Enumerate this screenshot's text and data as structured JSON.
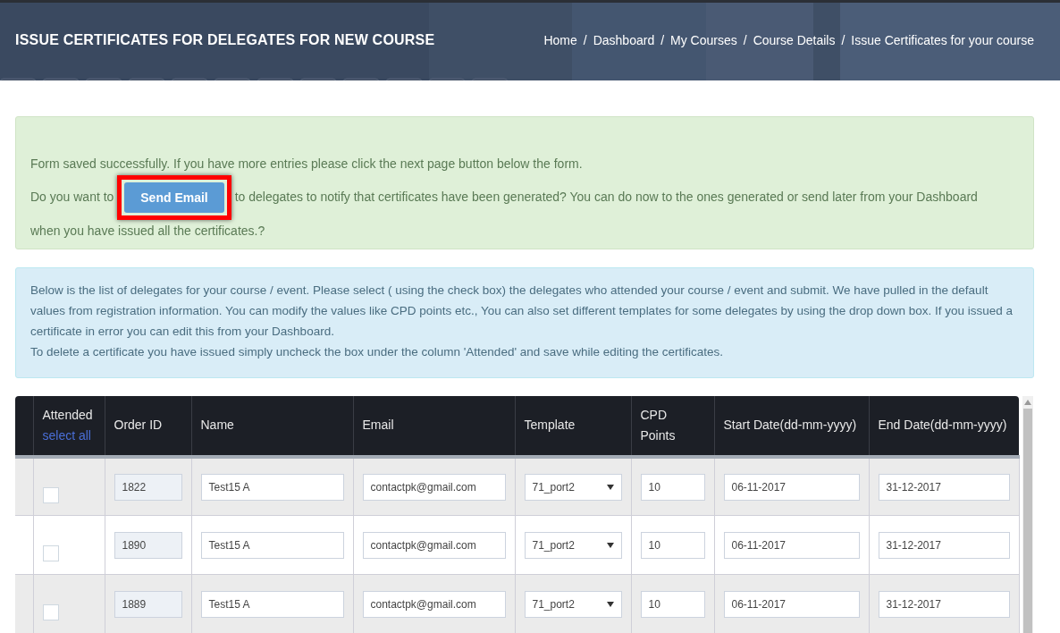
{
  "header": {
    "title": "ISSUE CERTIFICATES FOR DELEGATES FOR NEW COURSE",
    "breadcrumb_separator": "/",
    "breadcrumbs": [
      {
        "label": "Home"
      },
      {
        "label": "Dashboard"
      },
      {
        "label": "My Courses"
      },
      {
        "label": "Course Details"
      },
      {
        "label": "Issue Certificates for your course"
      }
    ]
  },
  "success_alert": {
    "message": "Form saved successfully. If you have more entries please click the next page button below the form.",
    "prompt_before": "Do you want to",
    "button": "Send Email",
    "prompt_after": "to delegates to notify that certificates have been generated? You can do now to the ones generated or send later from your Dashboard",
    "prompt_end": "when you have issued all the certificates.?",
    "highlighted": true
  },
  "info_alert": {
    "lines": [
      "Below is the list of delegates for your course / event. Please select ( using the check box) the delegates who attended your course / event and submit. We have pulled in the default values from registration information. You can modify the values like CPD points etc., You can also set different templates for some delegates by using the drop down box. If you issued a certificate in error you can edit this from your Dashboard.",
      "To delete a certificate you have issued simply uncheck the box under the column 'Attended' and save while editing the certificates."
    ]
  },
  "table": {
    "columns": [
      {
        "label": "Attended",
        "link": "select all"
      },
      {
        "label": "Order ID"
      },
      {
        "label": "Name"
      },
      {
        "label": "Email"
      },
      {
        "label": "Template"
      },
      {
        "label": "CPD Points"
      },
      {
        "label": "Start Date(dd-mm-yyyy)"
      },
      {
        "label": "End Date(dd-mm-yyyy)"
      }
    ],
    "rows": [
      {
        "attended": false,
        "order_id": "1822",
        "name": "Test15 A",
        "email": "contactpk@gmail.com",
        "template": "71_port2",
        "cpd_points": "10",
        "start_date": "06-11-2017",
        "end_date": "31-12-2017"
      },
      {
        "attended": false,
        "order_id": "1890",
        "name": "Test15 A",
        "email": "contactpk@gmail.com",
        "template": "71_port2",
        "cpd_points": "10",
        "start_date": "06-11-2017",
        "end_date": "31-12-2017"
      },
      {
        "attended": false,
        "order_id": "1889",
        "name": "Test15 A",
        "email": "contactpk@gmail.com",
        "template": "71_port2",
        "cpd_points": "10",
        "start_date": "06-11-2017",
        "end_date": "31-12-2017"
      }
    ]
  }
}
